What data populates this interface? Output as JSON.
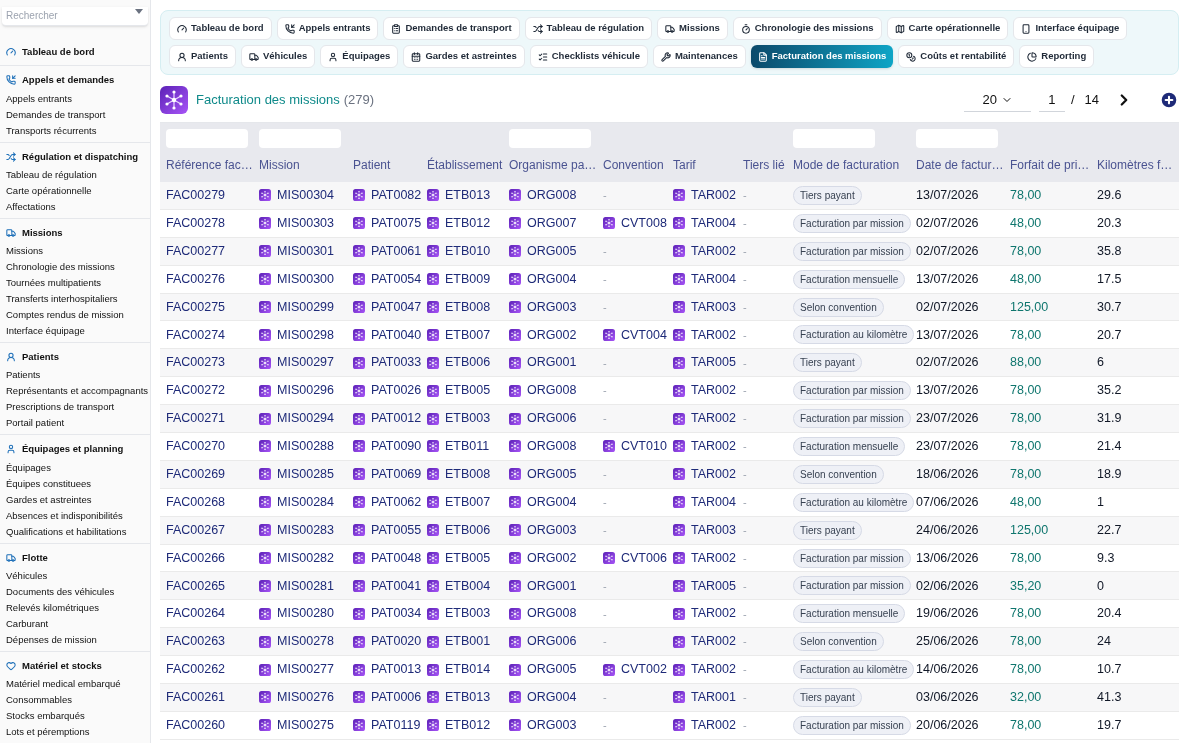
{
  "sidebar": {
    "search": {
      "placeholder": "Rechercher"
    },
    "sections": [
      {
        "title": "Tableau de bord"
      },
      {
        "title": "Appels et demandes",
        "items": [
          "Appels entrants",
          "Demandes de transport",
          "Transports récurrents"
        ]
      },
      {
        "title": "Régulation et dispatching",
        "items": [
          "Tableau de régulation",
          "Carte opérationnelle",
          "Affectations"
        ]
      },
      {
        "title": "Missions",
        "items": [
          "Missions",
          "Chronologie des missions",
          "Tournées multipatients",
          "Transferts interhospitaliers",
          "Comptes rendus de mission",
          "Interface équipage"
        ]
      },
      {
        "title": "Patients",
        "items": [
          "Patients",
          "Représentants et accompagnants",
          "Prescriptions de transport",
          "Portail patient"
        ]
      },
      {
        "title": "Équipages et planning",
        "items": [
          "Équipages",
          "Équipes constituees",
          "Gardes et astreintes",
          "Absences et indisponibilités",
          "Qualifications et habilitations"
        ]
      },
      {
        "title": "Flotte",
        "items": [
          "Véhicules",
          "Documents des véhicules",
          "Relevés kilométriques",
          "Carburant",
          "Dépenses de mission"
        ]
      },
      {
        "title": "Matériel et stocks",
        "items": [
          "Matériel medical embarqué",
          "Consommables",
          "Stocks embarqués",
          "Lots et péremptions"
        ]
      }
    ]
  },
  "tabs": [
    {
      "label": "Tableau de bord",
      "selected": false
    },
    {
      "label": "Appels entrants",
      "selected": false
    },
    {
      "label": "Demandes de transport",
      "selected": false
    },
    {
      "label": "Tableau de régulation",
      "selected": false
    },
    {
      "label": "Missions",
      "selected": false
    },
    {
      "label": "Chronologie des missions",
      "selected": false
    },
    {
      "label": "Carte opérationnelle",
      "selected": false
    },
    {
      "label": "Interface équipage",
      "selected": false
    },
    {
      "label": "Patients",
      "selected": false
    },
    {
      "label": "Véhicules",
      "selected": false
    },
    {
      "label": "Équipages",
      "selected": false
    },
    {
      "label": "Gardes et astreintes",
      "selected": false
    },
    {
      "label": "Checklists véhicule",
      "selected": false
    },
    {
      "label": "Maintenances",
      "selected": false
    },
    {
      "label": "Facturation des missions",
      "selected": true
    },
    {
      "label": "Coûts et rentabilité",
      "selected": false
    },
    {
      "label": "Reporting",
      "selected": false
    }
  ],
  "header": {
    "title": "Facturation des missions",
    "count": "(279)",
    "page_size": "20",
    "page": "1",
    "separator": "/",
    "total_pages": "14"
  },
  "table": {
    "columns": [
      {
        "label": "Référence fac…",
        "kind": "ref",
        "filter": true
      },
      {
        "label": "Mission",
        "kind": "link",
        "filter": true
      },
      {
        "label": "Patient",
        "kind": "link",
        "filter": false
      },
      {
        "label": "Établissement",
        "kind": "link",
        "filter": false
      },
      {
        "label": "Organisme pa…",
        "kind": "link",
        "filter": true
      },
      {
        "label": "Convention",
        "kind": "optional-link",
        "filter": false
      },
      {
        "label": "Tarif",
        "kind": "link",
        "filter": false
      },
      {
        "label": "Tiers lié",
        "kind": "empty",
        "filter": false
      },
      {
        "label": "Mode de facturation",
        "kind": "badge",
        "filter": true
      },
      {
        "label": "Date de factur…",
        "kind": "text",
        "filter": true
      },
      {
        "label": "Forfait de pri…",
        "kind": "money",
        "filter": false
      },
      {
        "label": "Kilomètres f…",
        "kind": "text",
        "filter": false
      }
    ],
    "rows": [
      {
        "cells": [
          "FAC00279",
          "MIS00304",
          "PAT0082",
          "ETB013",
          "ORG008",
          "-",
          "TAR002",
          "-",
          "Tiers payant",
          "13/07/2026",
          "78,00",
          "29.6"
        ],
        "convention_linked": false
      },
      {
        "cells": [
          "FAC00278",
          "MIS00303",
          "PAT0075",
          "ETB012",
          "ORG007",
          "CVT008",
          "TAR004",
          "-",
          "Facturation par mission",
          "02/07/2026",
          "48,00",
          "20.3"
        ],
        "convention_linked": true
      },
      {
        "cells": [
          "FAC00277",
          "MIS00301",
          "PAT0061",
          "ETB010",
          "ORG005",
          "-",
          "TAR002",
          "-",
          "Facturation par mission",
          "02/07/2026",
          "78,00",
          "35.8"
        ],
        "convention_linked": false
      },
      {
        "cells": [
          "FAC00276",
          "MIS00300",
          "PAT0054",
          "ETB009",
          "ORG004",
          "-",
          "TAR004",
          "-",
          "Facturation mensuelle",
          "13/07/2026",
          "48,00",
          "17.5"
        ],
        "convention_linked": false
      },
      {
        "cells": [
          "FAC00275",
          "MIS00299",
          "PAT0047",
          "ETB008",
          "ORG003",
          "-",
          "TAR003",
          "-",
          "Selon convention",
          "02/07/2026",
          "125,00",
          "30.7"
        ],
        "convention_linked": false
      },
      {
        "cells": [
          "FAC00274",
          "MIS00298",
          "PAT0040",
          "ETB007",
          "ORG002",
          "CVT004",
          "TAR002",
          "-",
          "Facturation au kilomètre",
          "13/07/2026",
          "78,00",
          "20.7"
        ],
        "convention_linked": true
      },
      {
        "cells": [
          "FAC00273",
          "MIS00297",
          "PAT0033",
          "ETB006",
          "ORG001",
          "-",
          "TAR005",
          "-",
          "Tiers payant",
          "02/07/2026",
          "88,00",
          "6"
        ],
        "convention_linked": false
      },
      {
        "cells": [
          "FAC00272",
          "MIS00296",
          "PAT0026",
          "ETB005",
          "ORG008",
          "-",
          "TAR002",
          "-",
          "Facturation par mission",
          "13/07/2026",
          "78,00",
          "35.2"
        ],
        "convention_linked": false
      },
      {
        "cells": [
          "FAC00271",
          "MIS00294",
          "PAT0012",
          "ETB003",
          "ORG006",
          "-",
          "TAR002",
          "-",
          "Facturation par mission",
          "23/07/2026",
          "78,00",
          "31.9"
        ],
        "convention_linked": false
      },
      {
        "cells": [
          "FAC00270",
          "MIS00288",
          "PAT0090",
          "ETB011",
          "ORG008",
          "CVT010",
          "TAR002",
          "-",
          "Facturation mensuelle",
          "23/07/2026",
          "78,00",
          "21.4"
        ],
        "convention_linked": true
      },
      {
        "cells": [
          "FAC00269",
          "MIS00285",
          "PAT0069",
          "ETB008",
          "ORG005",
          "-",
          "TAR002",
          "-",
          "Selon convention",
          "18/06/2026",
          "78,00",
          "18.9"
        ],
        "convention_linked": false
      },
      {
        "cells": [
          "FAC00268",
          "MIS00284",
          "PAT0062",
          "ETB007",
          "ORG004",
          "-",
          "TAR004",
          "-",
          "Facturation au kilomètre",
          "07/06/2026",
          "48,00",
          "1"
        ],
        "convention_linked": false
      },
      {
        "cells": [
          "FAC00267",
          "MIS00283",
          "PAT0055",
          "ETB006",
          "ORG003",
          "-",
          "TAR003",
          "-",
          "Tiers payant",
          "24/06/2026",
          "125,00",
          "22.7"
        ],
        "convention_linked": false
      },
      {
        "cells": [
          "FAC00266",
          "MIS00282",
          "PAT0048",
          "ETB005",
          "ORG002",
          "CVT006",
          "TAR002",
          "-",
          "Facturation par mission",
          "13/06/2026",
          "78,00",
          "9.3"
        ],
        "convention_linked": true
      },
      {
        "cells": [
          "FAC00265",
          "MIS00281",
          "PAT0041",
          "ETB004",
          "ORG001",
          "-",
          "TAR005",
          "-",
          "Facturation par mission",
          "02/06/2026",
          "35,20",
          "0"
        ],
        "convention_linked": false
      },
      {
        "cells": [
          "FAC00264",
          "MIS00280",
          "PAT0034",
          "ETB003",
          "ORG008",
          "-",
          "TAR002",
          "-",
          "Facturation mensuelle",
          "19/06/2026",
          "78,00",
          "20.4"
        ],
        "convention_linked": false
      },
      {
        "cells": [
          "FAC00263",
          "MIS00278",
          "PAT0020",
          "ETB001",
          "ORG006",
          "-",
          "TAR002",
          "-",
          "Selon convention",
          "25/06/2026",
          "78,00",
          "24"
        ],
        "convention_linked": false
      },
      {
        "cells": [
          "FAC00262",
          "MIS00277",
          "PAT0013",
          "ETB014",
          "ORG005",
          "CVT002",
          "TAR002",
          "-",
          "Facturation au kilomètre",
          "14/06/2026",
          "78,00",
          "10.7"
        ],
        "convention_linked": true
      },
      {
        "cells": [
          "FAC00261",
          "MIS00276",
          "PAT0006",
          "ETB013",
          "ORG004",
          "-",
          "TAR001",
          "-",
          "Tiers payant",
          "03/06/2026",
          "32,00",
          "41.3"
        ],
        "convention_linked": false
      },
      {
        "cells": [
          "FAC00260",
          "MIS00275",
          "PAT0119",
          "ETB012",
          "ORG003",
          "-",
          "TAR002",
          "-",
          "Facturation par mission",
          "20/06/2026",
          "78,00",
          "19.7"
        ],
        "convention_linked": false
      }
    ]
  }
}
